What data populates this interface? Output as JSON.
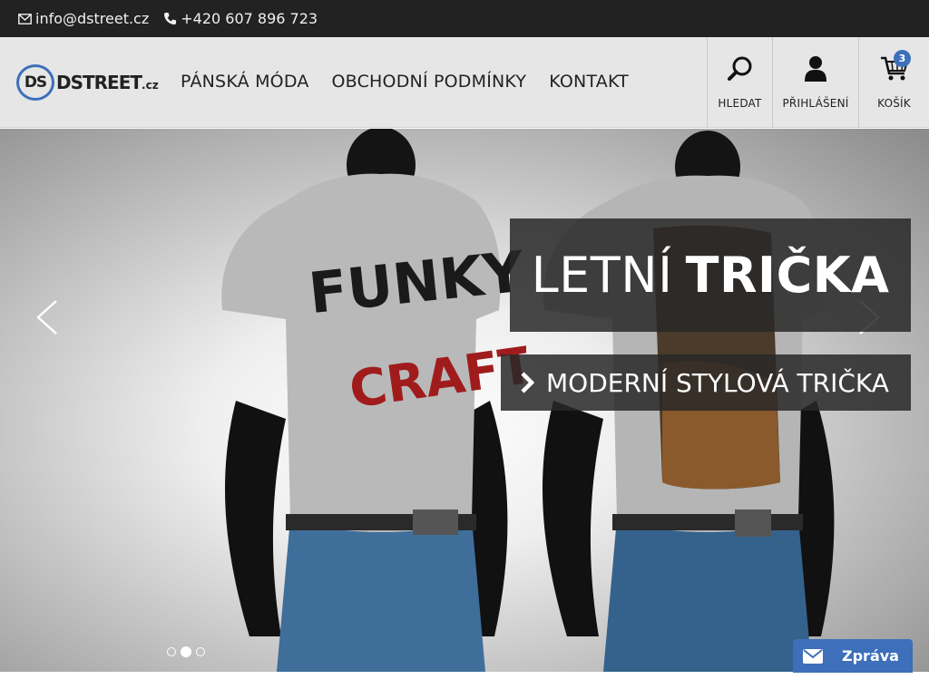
{
  "topbar": {
    "email": "info@dstreet.cz",
    "phone": "+420 607 896 723"
  },
  "logo": {
    "mark": "DS",
    "name": "DSTREET",
    "tld": ".cz"
  },
  "nav": {
    "items": [
      "PÁNSKÁ MÓDA",
      "OBCHODNÍ PODMÍNKY",
      "KONTAKT"
    ]
  },
  "tools": {
    "search_label": "HLEDAT",
    "login_label": "PŘIHLÁŠENÍ",
    "cart_label": "KOŠÍK",
    "cart_count": "3"
  },
  "hero": {
    "title_light": "LETNÍ",
    "title_bold": "TRIČKA",
    "subtitle": "MODERNÍ STYLOVÁ TRIČKA",
    "shirt_left_line1": "FUNKY",
    "shirt_left_line2": "CRAFT",
    "slides": 3,
    "active_slide": 2
  },
  "chat": {
    "label": "Zpráva"
  },
  "colors": {
    "accent": "#3d6fba",
    "topbar": "#222222",
    "header": "#e6e6e6"
  }
}
